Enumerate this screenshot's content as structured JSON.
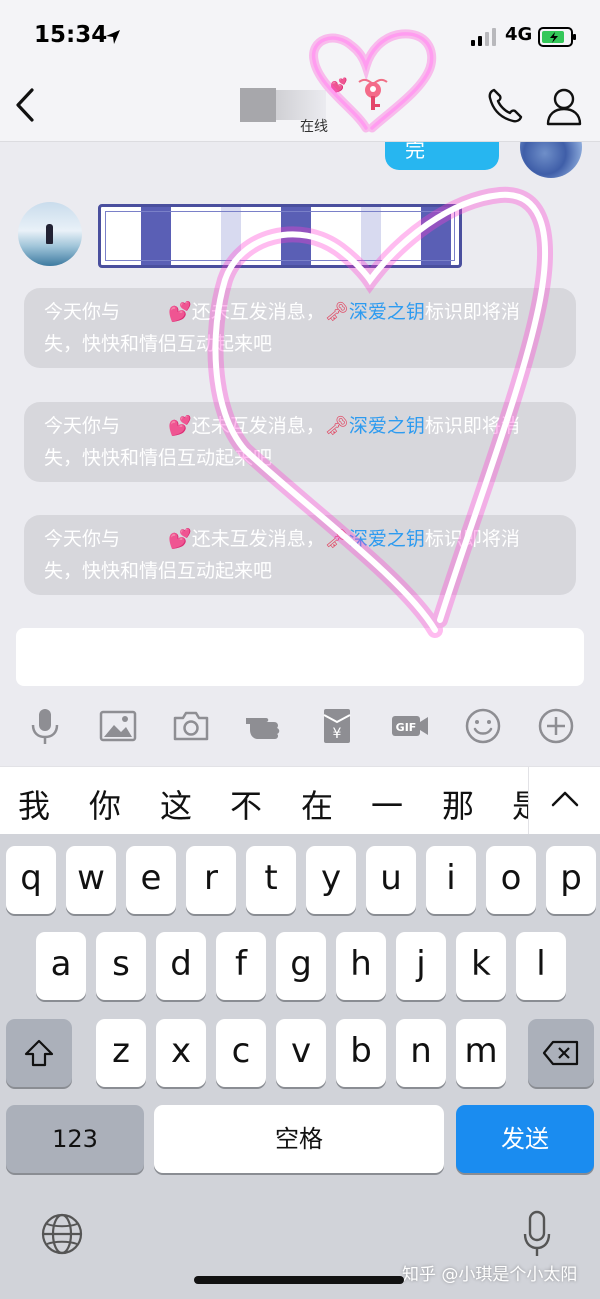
{
  "status_bar": {
    "time": "15:34",
    "network": "4G"
  },
  "nav": {
    "online_status": "在线",
    "heart_emoji": "💕"
  },
  "chat": {
    "outgoing_text": "完",
    "system_messages": [
      {
        "line1_prefix": "今天你与",
        "emoji": "💕",
        "line1_mid": "还未互发消息，",
        "key_emoji": "🗝",
        "highlight": "深爱之钥",
        "line1_suffix": "标识即将消",
        "line2": "失，快快和情侣互动起来吧"
      },
      {
        "line1_prefix": "今天你与",
        "emoji": "💕",
        "line1_mid": "还未互发消息，",
        "key_emoji": "🗝",
        "highlight": "深爱之钥",
        "line1_suffix": "标识即将消",
        "line2": "失，快快和情侣互动起来吧"
      },
      {
        "line1_prefix": "今天你与",
        "emoji": "💕",
        "line1_mid": "还未互发消息，",
        "key_emoji": "🗝",
        "highlight": "深爱之钥",
        "line1_suffix": "标识即将消",
        "line2": "失，快快和情侣互动起来吧"
      }
    ]
  },
  "toolbar": {
    "icons": [
      "microphone-icon",
      "image-icon",
      "camera-icon",
      "poke-hand-icon",
      "red-envelope-icon",
      "gif-icon",
      "emoji-icon",
      "add-icon"
    ],
    "gif_label": "GIF",
    "yen_label": "¥"
  },
  "candidates": [
    "我",
    "你",
    "这",
    "不",
    "在",
    "一",
    "那",
    "是"
  ],
  "keyboard": {
    "row1": [
      "q",
      "w",
      "e",
      "r",
      "t",
      "y",
      "u",
      "i",
      "o",
      "p"
    ],
    "row2": [
      "a",
      "s",
      "d",
      "f",
      "g",
      "h",
      "j",
      "k",
      "l"
    ],
    "row3": [
      "z",
      "x",
      "c",
      "v",
      "b",
      "n",
      "m"
    ],
    "num_label": "123",
    "space_label": "空格",
    "send_label": "发送"
  },
  "watermark": "知乎 @小琪是个小太阳",
  "colors": {
    "accent_blue": "#1a8cf0",
    "bubble_blue": "#27b6f0",
    "highlight_blue": "#2d9bf0",
    "heart_pink": "#ff3fd4"
  }
}
